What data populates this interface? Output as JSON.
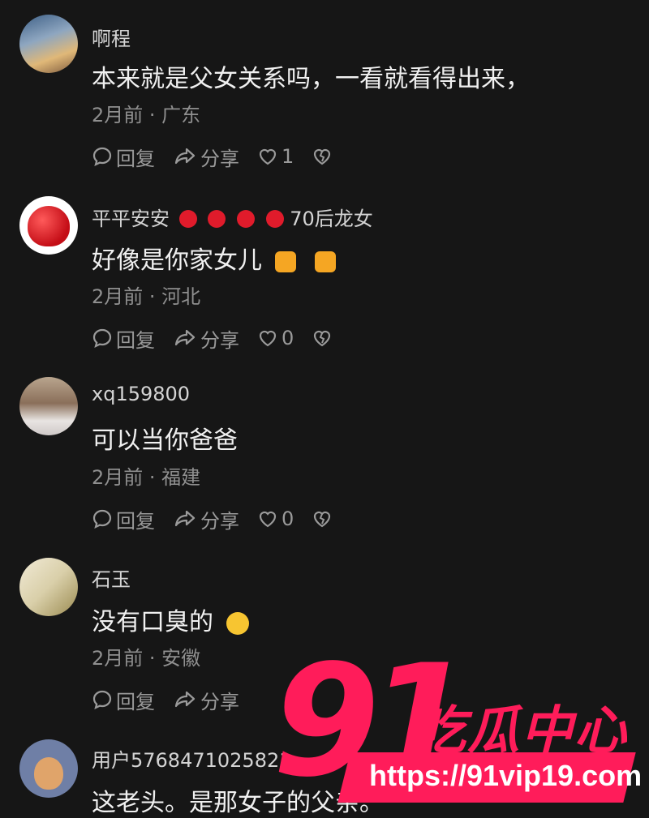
{
  "comments": [
    {
      "username": "啊程",
      "text": "本来就是父女关系吗，一看就看得出来，",
      "meta": "2月前 · 广东",
      "reply_label": "回复",
      "share_label": "分享",
      "like_count": "1"
    },
    {
      "username": "平平安安",
      "username_suffix": "70后龙女",
      "text": "好像是你家女儿",
      "meta": "2月前 · 河北",
      "reply_label": "回复",
      "share_label": "分享",
      "like_count": "0"
    },
    {
      "username": "xq159800",
      "text": "可以当你爸爸",
      "meta": "2月前 · 福建",
      "reply_label": "回复",
      "share_label": "分享",
      "like_count": "0"
    },
    {
      "username": "石玉",
      "text": "没有口臭的",
      "meta": "2月前 · 安徽",
      "reply_label": "回复",
      "share_label": "分享"
    },
    {
      "username": "用户5768471025821",
      "text": "这老头。是那女子的父亲。"
    }
  ],
  "watermark": {
    "number": "91",
    "title": "吃瓜中心",
    "url": "https://91vip19.com",
    "color": "#ff1c5a"
  },
  "icons": {
    "reply": "reply-bubble-icon",
    "share": "share-arrow-icon",
    "like": "heart-icon",
    "dislike": "broken-heart-icon"
  }
}
